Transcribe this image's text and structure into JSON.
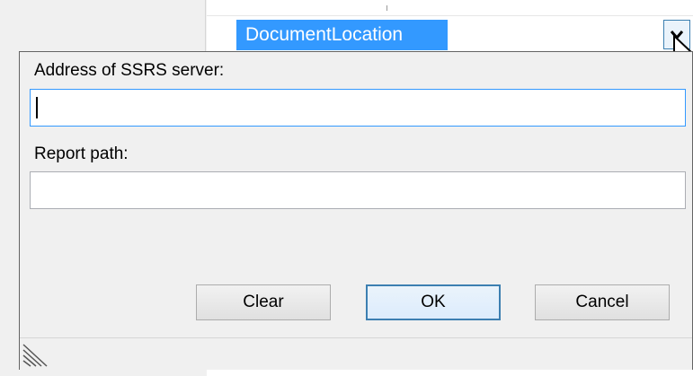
{
  "property": {
    "selected_value": "DocumentLocation"
  },
  "dialog": {
    "server_label": "Address of SSRS server:",
    "server_value": "",
    "path_label": "Report path:",
    "path_value": "",
    "buttons": {
      "clear": "Clear",
      "ok": "OK",
      "cancel": "Cancel"
    }
  },
  "icons": [
    "chevron-down-icon",
    "mouse-cursor-icon",
    "resize-grip-icon"
  ],
  "colors": {
    "selection": "#3399ff",
    "focus_border": "#3399ff",
    "dialog_bg": "#f0f0f0"
  }
}
